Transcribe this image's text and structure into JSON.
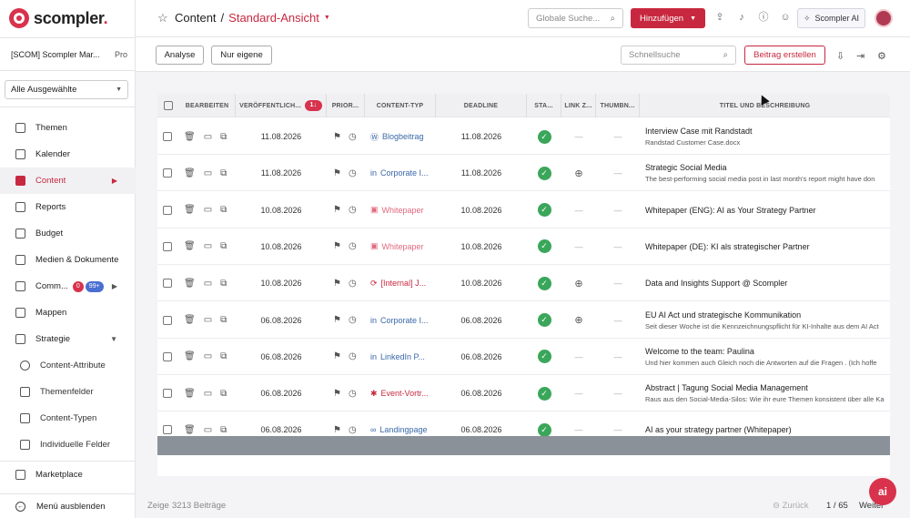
{
  "brand": {
    "name": "scompler",
    "dot": "."
  },
  "org": {
    "name": "[SCOM] Scompler Mar...",
    "plan": "Pro"
  },
  "filter_select": {
    "value": "Alle Ausgewählte"
  },
  "sidebar": {
    "partial_item": "Themen",
    "items": [
      {
        "label": "Themen",
        "icon": "topics-icon"
      },
      {
        "label": "Kalender",
        "icon": "calendar-icon"
      },
      {
        "label": "Content",
        "icon": "table-icon",
        "active": true
      },
      {
        "label": "Reports",
        "icon": "monitor-icon"
      },
      {
        "label": "Budget",
        "icon": "coins-icon"
      },
      {
        "label": "Medien & Dokumente",
        "icon": "document-icon"
      },
      {
        "label": "Comm...",
        "icon": "comments-icon",
        "badge_red": "0",
        "badge_blue": "99+"
      },
      {
        "label": "Mappen",
        "icon": "folder-icon"
      },
      {
        "label": "Strategie",
        "icon": "sliders-icon"
      }
    ],
    "subitems": [
      {
        "label": "Content-Attribute",
        "icon": "attributes-icon"
      },
      {
        "label": "Themenfelder",
        "icon": "list-icon"
      },
      {
        "label": "Content-Typen",
        "icon": "layers-icon"
      },
      {
        "label": "Individuelle Felder",
        "icon": "fields-icon"
      }
    ],
    "marketplace": "Marketplace",
    "hide_menu": "Menü ausblenden"
  },
  "header": {
    "crumb_root": "Content",
    "crumb_sep": "/",
    "crumb_view": "Standard-Ansicht",
    "global_search_placeholder": "Globale Suche...",
    "add_button": "Hinzufügen",
    "ai_button": "Scompler AI"
  },
  "toolbar": {
    "analyse": "Analyse",
    "mine": "Nur eigene",
    "quick_search_placeholder": "Schnellsuche",
    "create_post": "Beitrag erstellen"
  },
  "table": {
    "headers": {
      "edit": "BEARBEITEN",
      "published": "VERÖFFENTLICH...",
      "sort_badge": "1↓",
      "priority": "PRIOR...",
      "content_type": "CONTENT-TYP",
      "deadline": "DEADLINE",
      "status": "STA...",
      "link": "LINK Z...",
      "thumb": "THUMBN...",
      "title": "TITEL UND BESCHREIBUNG"
    },
    "rows": [
      {
        "published": "11.08.2026",
        "type": "Blogbeitrag",
        "type_icon": "wordpress-icon",
        "type_style": "wp",
        "deadline": "11.08.2026",
        "link": "-",
        "title": "Interview Case mit Randstadt",
        "desc": "Randstad Customer Case.docx"
      },
      {
        "published": "11.08.2026",
        "type": "Corporate I...",
        "type_icon": "linkedin-icon",
        "type_style": "wp",
        "deadline": "11.08.2026",
        "link": "globe",
        "title": "Strategic Social Media",
        "desc": "The best-performing social media post in last month's report might have don"
      },
      {
        "published": "10.08.2026",
        "type": "Whitepaper",
        "type_icon": "image-icon",
        "type_style": "pink",
        "deadline": "10.08.2026",
        "link": "-",
        "title": "Whitepaper (ENG): AI as Your Strategy Partner",
        "desc": ""
      },
      {
        "published": "10.08.2026",
        "type": "Whitepaper",
        "type_icon": "image-icon",
        "type_style": "pink",
        "deadline": "10.08.2026",
        "link": "-",
        "title": "Whitepaper (DE): KI als strategischer Partner",
        "desc": ""
      },
      {
        "published": "10.08.2026",
        "type": "[Internal] J...",
        "type_icon": "sync-icon",
        "type_style": "red",
        "deadline": "10.08.2026",
        "link": "globe",
        "title": "Data and Insights Support @ Scompler",
        "desc": ""
      },
      {
        "published": "06.08.2026",
        "type": "Corporate I...",
        "type_icon": "linkedin-icon",
        "type_style": "wp",
        "deadline": "06.08.2026",
        "link": "globe",
        "title": "EU AI Act und strategische Kommunikation",
        "desc": "Seit dieser Woche ist die Kennzeichnungspflicht für KI-Inhalte aus dem AI Act"
      },
      {
        "published": "06.08.2026",
        "type": "LinkedIn P...",
        "type_icon": "linkedin-icon",
        "type_style": "wp",
        "deadline": "06.08.2026",
        "link": "-",
        "title": "Welcome to the team: Paulina",
        "desc": "Und hier kommen auch Gleich noch die Antworten auf die Fragen . (Ich hoffe"
      },
      {
        "published": "06.08.2026",
        "type": "Event-Vortr...",
        "type_icon": "people-icon",
        "type_style": "red",
        "deadline": "06.08.2026",
        "link": "-",
        "title": "Abstract | Tagung Social Media Management",
        "desc": "Raus aus den Social-Media-Silos: Wie ihr eure Themen konsistent über alle Ka"
      },
      {
        "published": "06.08.2026",
        "type": "Landingpage",
        "type_icon": "link-icon",
        "type_style": "wp",
        "deadline": "06.08.2026",
        "link": "-",
        "title": "AI as your strategy partner (Whitepaper)",
        "desc": ""
      }
    ]
  },
  "footer": {
    "count_label": "Zeige",
    "count_value": "3213 Beiträge",
    "back": "Zurück",
    "page": "1 / 65",
    "next": "Weiter"
  },
  "fab": {
    "label": "ai"
  },
  "colors": {
    "brand": "#c8283f",
    "status_ok": "#3aa65a",
    "link_blue": "#3a68a8"
  }
}
